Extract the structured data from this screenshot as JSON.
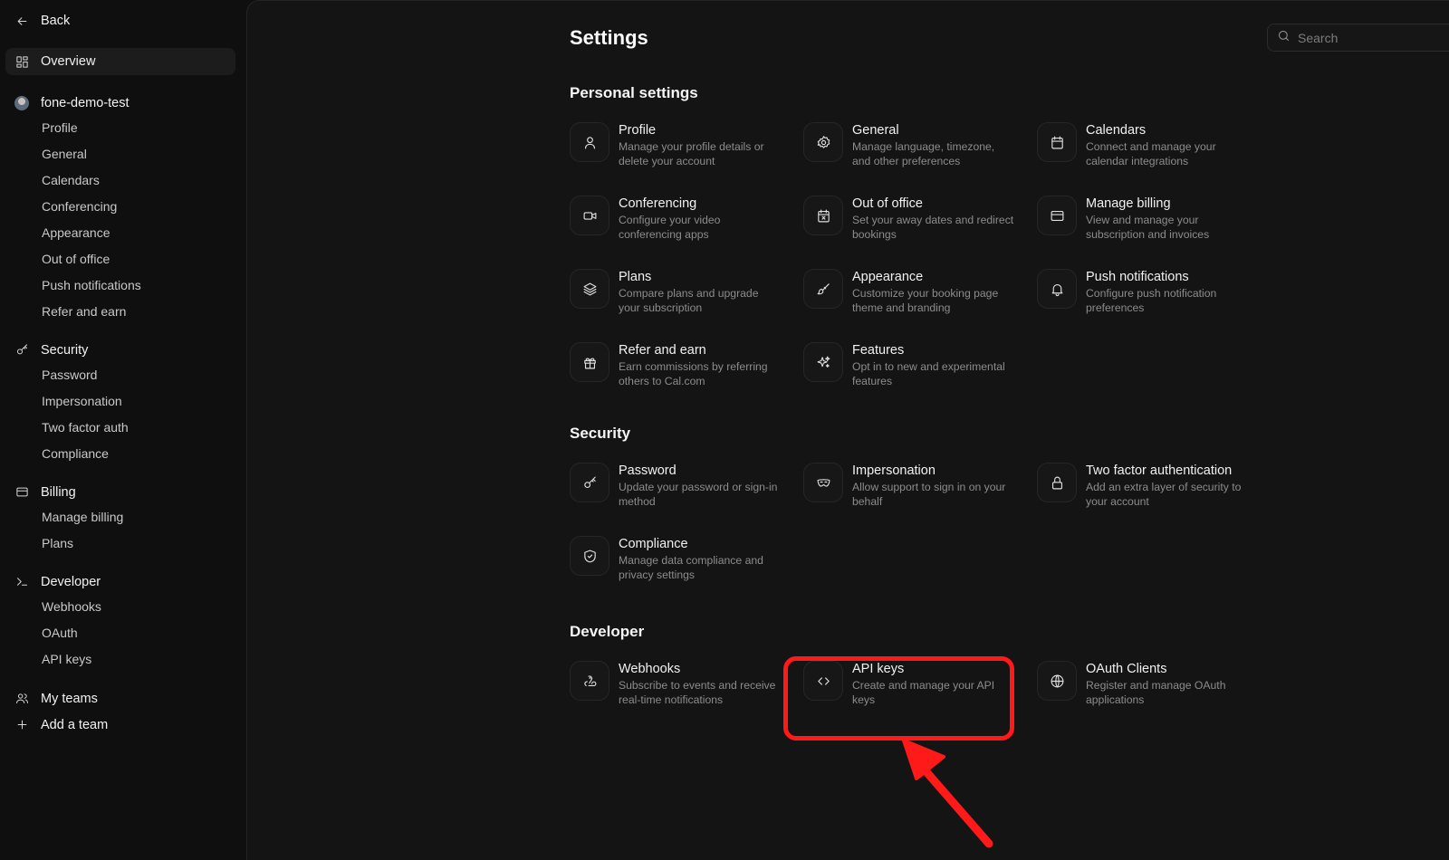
{
  "sidebar": {
    "back_label": "Back",
    "overview_label": "Overview",
    "groups": [
      {
        "label": "fone-demo-test",
        "icon": "avatar",
        "items": [
          "Profile",
          "General",
          "Calendars",
          "Conferencing",
          "Appearance",
          "Out of office",
          "Push notifications",
          "Refer and earn"
        ]
      },
      {
        "label": "Security",
        "icon": "key-icon",
        "items": [
          "Password",
          "Impersonation",
          "Two factor auth",
          "Compliance"
        ]
      },
      {
        "label": "Billing",
        "icon": "credit-card-icon",
        "items": [
          "Manage billing",
          "Plans"
        ]
      },
      {
        "label": "Developer",
        "icon": "terminal-icon",
        "items": [
          "Webhooks",
          "OAuth",
          "API keys"
        ]
      }
    ],
    "my_teams_label": "My teams",
    "add_team_label": "Add a team"
  },
  "header": {
    "title": "Settings",
    "search_placeholder": "Search"
  },
  "sections": [
    {
      "title": "Personal settings",
      "cards": [
        {
          "title": "Profile",
          "desc": "Manage your profile details or delete your account",
          "icon": "user-icon"
        },
        {
          "title": "General",
          "desc": "Manage language, timezone, and other preferences",
          "icon": "gear-icon"
        },
        {
          "title": "Calendars",
          "desc": "Connect and manage your calendar integrations",
          "icon": "calendar-icon"
        },
        {
          "title": "Conferencing",
          "desc": "Configure your video conferencing apps",
          "icon": "video-icon"
        },
        {
          "title": "Out of office",
          "desc": "Set your away dates and redirect bookings",
          "icon": "calendar-x-icon"
        },
        {
          "title": "Manage billing",
          "desc": "View and manage your subscription and invoices",
          "icon": "credit-card-icon"
        },
        {
          "title": "Plans",
          "desc": "Compare plans and upgrade your subscription",
          "icon": "layers-icon"
        },
        {
          "title": "Appearance",
          "desc": "Customize your booking page theme and branding",
          "icon": "brush-icon"
        },
        {
          "title": "Push notifications",
          "desc": "Configure push notification preferences",
          "icon": "bell-icon"
        },
        {
          "title": "Refer and earn",
          "desc": "Earn commissions by referring others to Cal.com",
          "icon": "gift-icon"
        },
        {
          "title": "Features",
          "desc": "Opt in to new and experimental features",
          "icon": "sparkles-icon"
        }
      ]
    },
    {
      "title": "Security",
      "cards": [
        {
          "title": "Password",
          "desc": "Update your password or sign-in method",
          "icon": "key-icon"
        },
        {
          "title": "Impersonation",
          "desc": "Allow support to sign in on your behalf",
          "icon": "mask-icon"
        },
        {
          "title": "Two factor authentication",
          "desc": "Add an extra layer of security to your account",
          "icon": "lock-icon"
        },
        {
          "title": "Compliance",
          "desc": "Manage data compliance and privacy settings",
          "icon": "shield-check-icon"
        }
      ]
    },
    {
      "title": "Developer",
      "cards": [
        {
          "title": "Webhooks",
          "desc": "Subscribe to events and receive real-time notifications",
          "icon": "webhook-icon"
        },
        {
          "title": "API keys",
          "desc": "Create and manage your API keys",
          "icon": "code-icon"
        },
        {
          "title": "OAuth Clients",
          "desc": "Register and manage OAuth applications",
          "icon": "globe-icon"
        }
      ]
    }
  ],
  "annotation": {
    "highlight_color": "#ff1a1a",
    "target": "API keys"
  }
}
